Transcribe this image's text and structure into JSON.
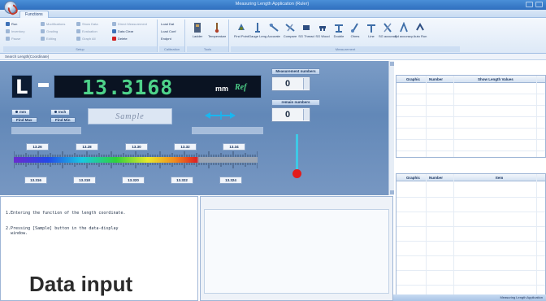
{
  "window": {
    "title": "Measuring Length Application (Ruler)"
  },
  "tabs": [
    {
      "label": "Functions"
    }
  ],
  "ribbon": {
    "left_items": [
      {
        "label": "Run"
      },
      {
        "label": "Modifications"
      },
      {
        "label": "Show Data"
      },
      {
        "label": "Direct Measurement"
      },
      {
        "label": "Inventory"
      },
      {
        "label": "Grading"
      },
      {
        "label": "Evaluation"
      },
      {
        "label": "Pause"
      },
      {
        "label": "Editing"
      },
      {
        "label": "Graph All"
      },
      {
        "label": "Clear"
      },
      {
        "label": "Data Clear"
      },
      {
        "label": "Data Set"
      },
      {
        "label": "Cost"
      },
      {
        "label": "Delete"
      }
    ],
    "right_mini": [
      {
        "label": "Load Dat"
      },
      {
        "label": "Load Conf"
      },
      {
        "label": "Endpnt"
      }
    ],
    "big_buttons": [
      {
        "label": "Ladder"
      },
      {
        "label": "Temperature"
      },
      {
        "label": "Find Point"
      },
      {
        "label": "Gauge Length"
      },
      {
        "label": "Accurate"
      },
      {
        "label": "Compare"
      },
      {
        "label": "SG Thread"
      },
      {
        "label": "SG Wood"
      },
      {
        "label": "Double"
      },
      {
        "label": "Ohms"
      },
      {
        "label": "Line"
      },
      {
        "label": "SG accuracy"
      },
      {
        "label": "Bd accuracy"
      },
      {
        "label": "Auto Run"
      }
    ],
    "groups": [
      {
        "label": "Setup"
      },
      {
        "label": "Calibration"
      },
      {
        "label": "Tools"
      },
      {
        "label": "Measurement"
      }
    ]
  },
  "address": {
    "text": "Search Length(Coordinate)"
  },
  "display": {
    "axis_letter": "L",
    "value": "13.3168",
    "unit": "mm",
    "ref": "Ref",
    "sample_button": "Sample"
  },
  "unit_buttons": [
    {
      "label": "mm"
    },
    {
      "label": "Inch"
    }
  ],
  "find_buttons": [
    {
      "label": "Find Max"
    },
    {
      "label": "Find Min"
    }
  ],
  "scale": {
    "top_ticks": [
      "13.26",
      "13.28",
      "13.30",
      "13.32",
      "13.34"
    ],
    "bottom_ticks": [
      "13.316",
      "13.318",
      "13.320",
      "13.322",
      "13.324"
    ]
  },
  "measurements": {
    "measurement_label": "Measurement numbers",
    "measurement_value": "0",
    "remain_label": "remain numbers",
    "remain_value": "0"
  },
  "grid_top": {
    "headers": [
      "Graphic",
      "Number",
      "Show Length Values"
    ]
  },
  "grid_bottom": {
    "headers": [
      "Graphic",
      "Number",
      "Item"
    ]
  },
  "help": {
    "lines": [
      "1.Entering the function of the length coordinate.",
      "2.Pressing [Sample] button in the data-display",
      "  window."
    ]
  },
  "caption": "Data input",
  "status": {
    "text": "Measuring Length Application"
  },
  "colors": {
    "readout_green": "#4ed38a",
    "panel_blue": "#6a8fbe",
    "alert_red": "#e31b1b",
    "indicator_cyan": "#3ec9e6"
  }
}
